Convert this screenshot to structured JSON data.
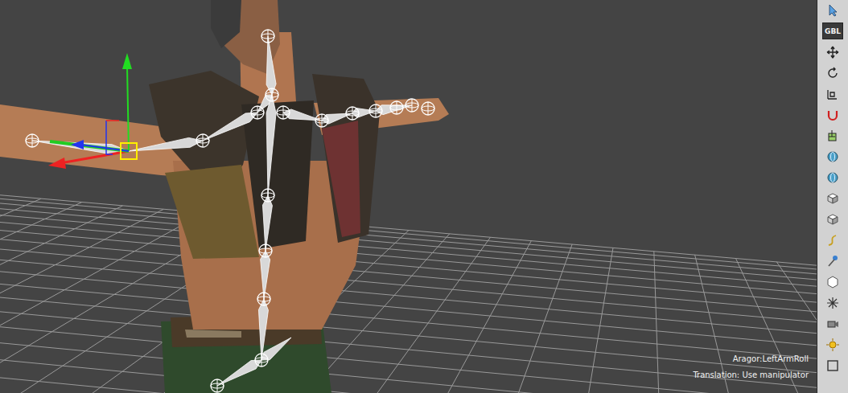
{
  "viewport": {
    "selection": "Aragor:LeftArmRoll",
    "mode": "Translation: Use manipulator"
  },
  "toolbar": {
    "space_button": {
      "label": "GBL",
      "selected": true
    }
  }
}
